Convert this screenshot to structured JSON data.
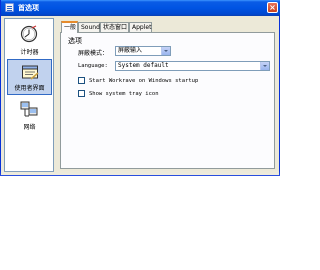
{
  "window": {
    "title": "首选项",
    "close_symbol": "×"
  },
  "sidebar": {
    "items": [
      {
        "label": "计时器",
        "icon": "timer-icon",
        "selected": false
      },
      {
        "label": "使用者界面",
        "icon": "user-interface-icon",
        "selected": true
      },
      {
        "label": "网络",
        "icon": "network-icon",
        "selected": false
      }
    ]
  },
  "tabs": [
    {
      "label": "一般",
      "active": true
    },
    {
      "label": "Sounds",
      "active": false
    },
    {
      "label": "状态窗口",
      "active": false
    },
    {
      "label": "Applet",
      "active": false
    }
  ],
  "general": {
    "section_title": "选项",
    "screensaver_mode": {
      "label": "屏蔽模式：",
      "value": "屏蔽输入"
    },
    "language": {
      "label": "Language:",
      "value": "System default"
    },
    "start_startup": {
      "label": "Start Workrave on Windows startup",
      "checked": false
    },
    "tray_icon": {
      "label": "Show system tray icon",
      "checked": false
    }
  }
}
